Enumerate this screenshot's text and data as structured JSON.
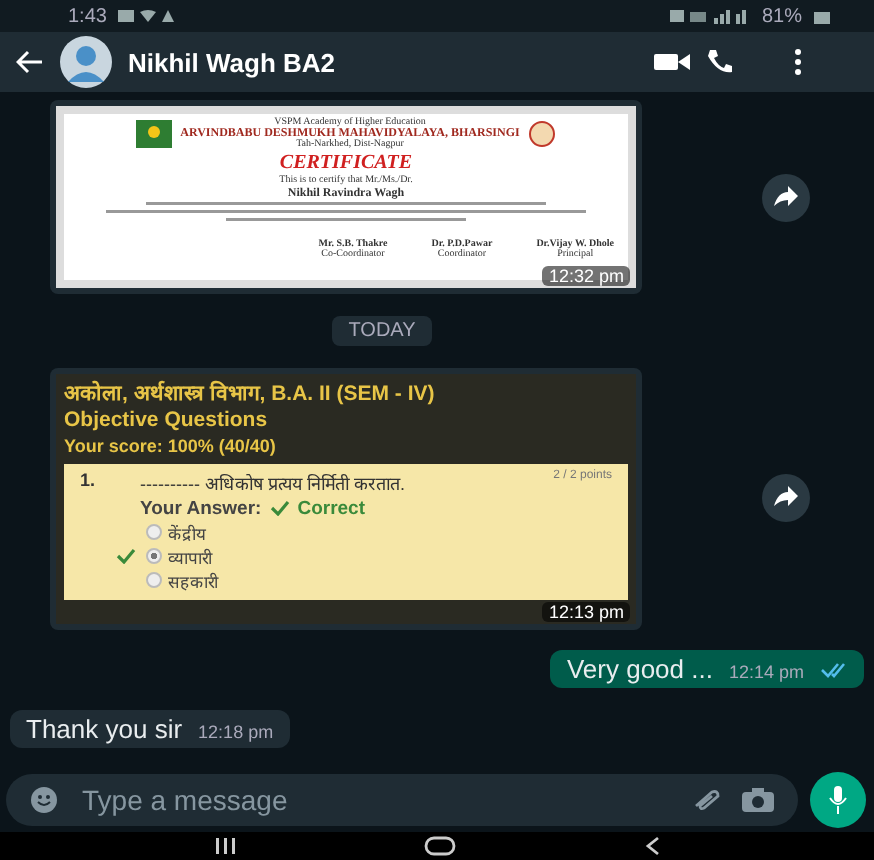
{
  "status_bar": {
    "time": "1:43",
    "battery": "81%"
  },
  "header": {
    "contact_name": "Nikhil Wagh BA2"
  },
  "certificate_message": {
    "institution": "VSPM Academy of Higher Education",
    "college": "ARVINDBABU DESHMUKH MAHAVIDYALAYA, BHARSINGI",
    "place": "Tah-Narkhed, Dist-Nagpur",
    "title": "CERTIFICATE",
    "certify_line": "This is to certify that Mr./Ms./Dr.",
    "recipient": "Nikhil Ravindra Wagh",
    "signatories": [
      {
        "name": "Mr. S.B. Thakre",
        "role": "Co-Coordinator"
      },
      {
        "name": "Dr. P.D.Pawar",
        "role": "Coordinator"
      },
      {
        "name": "Dr.Vijay W. Dhole",
        "role": "Principal"
      }
    ],
    "time": "12:32 pm"
  },
  "date_chip": "TODAY",
  "quiz_message": {
    "heading": "अकोला, अर्थशास्त्र विभाग, B.A. II (SEM - IV)",
    "subheading": "Objective Questions",
    "score": "Your score: 100% (40/40)",
    "question_number": "1.",
    "question": "---------- अधिकोष प्रत्यय निर्मिती करतात.",
    "points": "2 / 2 points",
    "answer_label": "Your Answer:",
    "verdict": "Correct",
    "options": [
      {
        "label": "केंद्रीय",
        "selected": false
      },
      {
        "label": "व्यापारी",
        "selected": true
      },
      {
        "label": "सहकारी",
        "selected": false
      }
    ],
    "time": "12:13 pm"
  },
  "text_messages": [
    {
      "kind": "outgoing",
      "text": "Very good ...",
      "time": "12:14 pm",
      "read": true
    },
    {
      "kind": "incoming",
      "text": "Thank you sir",
      "time": "12:18 pm"
    }
  ],
  "composer": {
    "placeholder": "Type a message"
  }
}
